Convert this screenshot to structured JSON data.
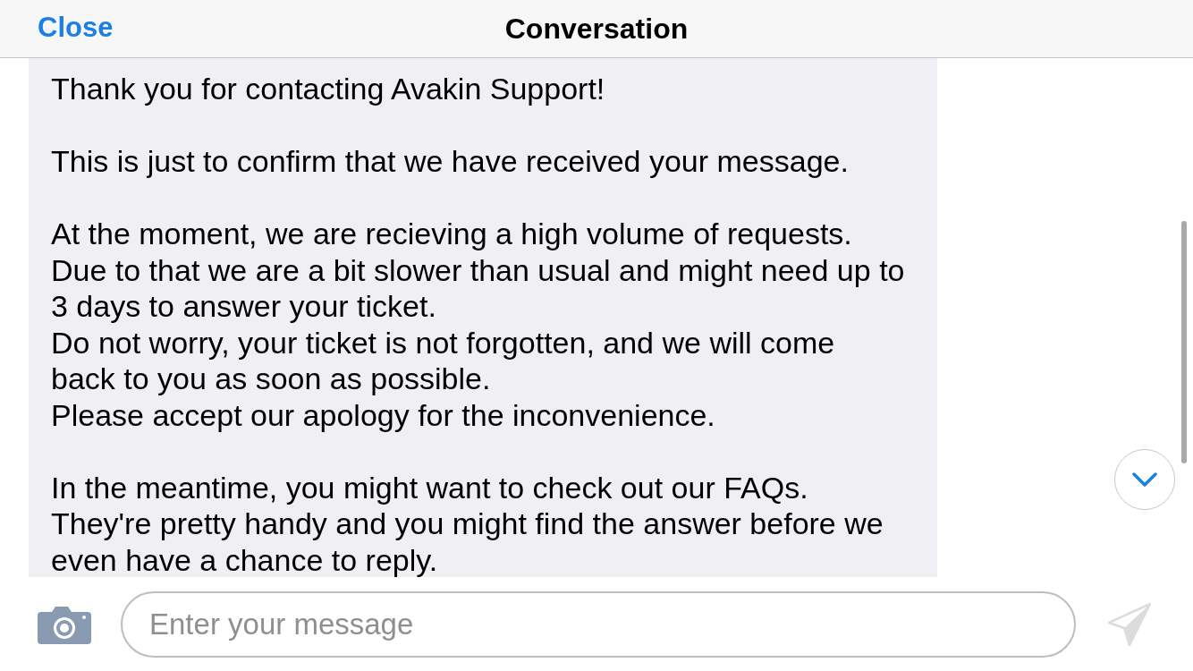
{
  "header": {
    "close_label": "Close",
    "title": "Conversation"
  },
  "message": {
    "paragraphs": [
      {
        "lines": [
          "Thank you for contacting Avakin Support!"
        ]
      },
      {
        "lines": [
          "This is just to confirm that we have received your message."
        ]
      },
      {
        "lines": [
          "At the moment, we are recieving a high volume of requests.",
          "Due to that we are a bit slower than usual and might need up to",
          "3 days to answer your ticket.",
          "Do not worry, your ticket is not forgotten, and we will come",
          "back to you as soon as possible.",
          "Please accept our apology for the inconvenience."
        ]
      },
      {
        "lines": [
          "In the meantime, you might want to check out our FAQs.",
          "They're pretty handy and you might find the answer before we",
          "even have a chance to reply."
        ]
      }
    ]
  },
  "composer": {
    "placeholder": "Enter your message",
    "send_button": {
      "disabled": true
    }
  }
}
